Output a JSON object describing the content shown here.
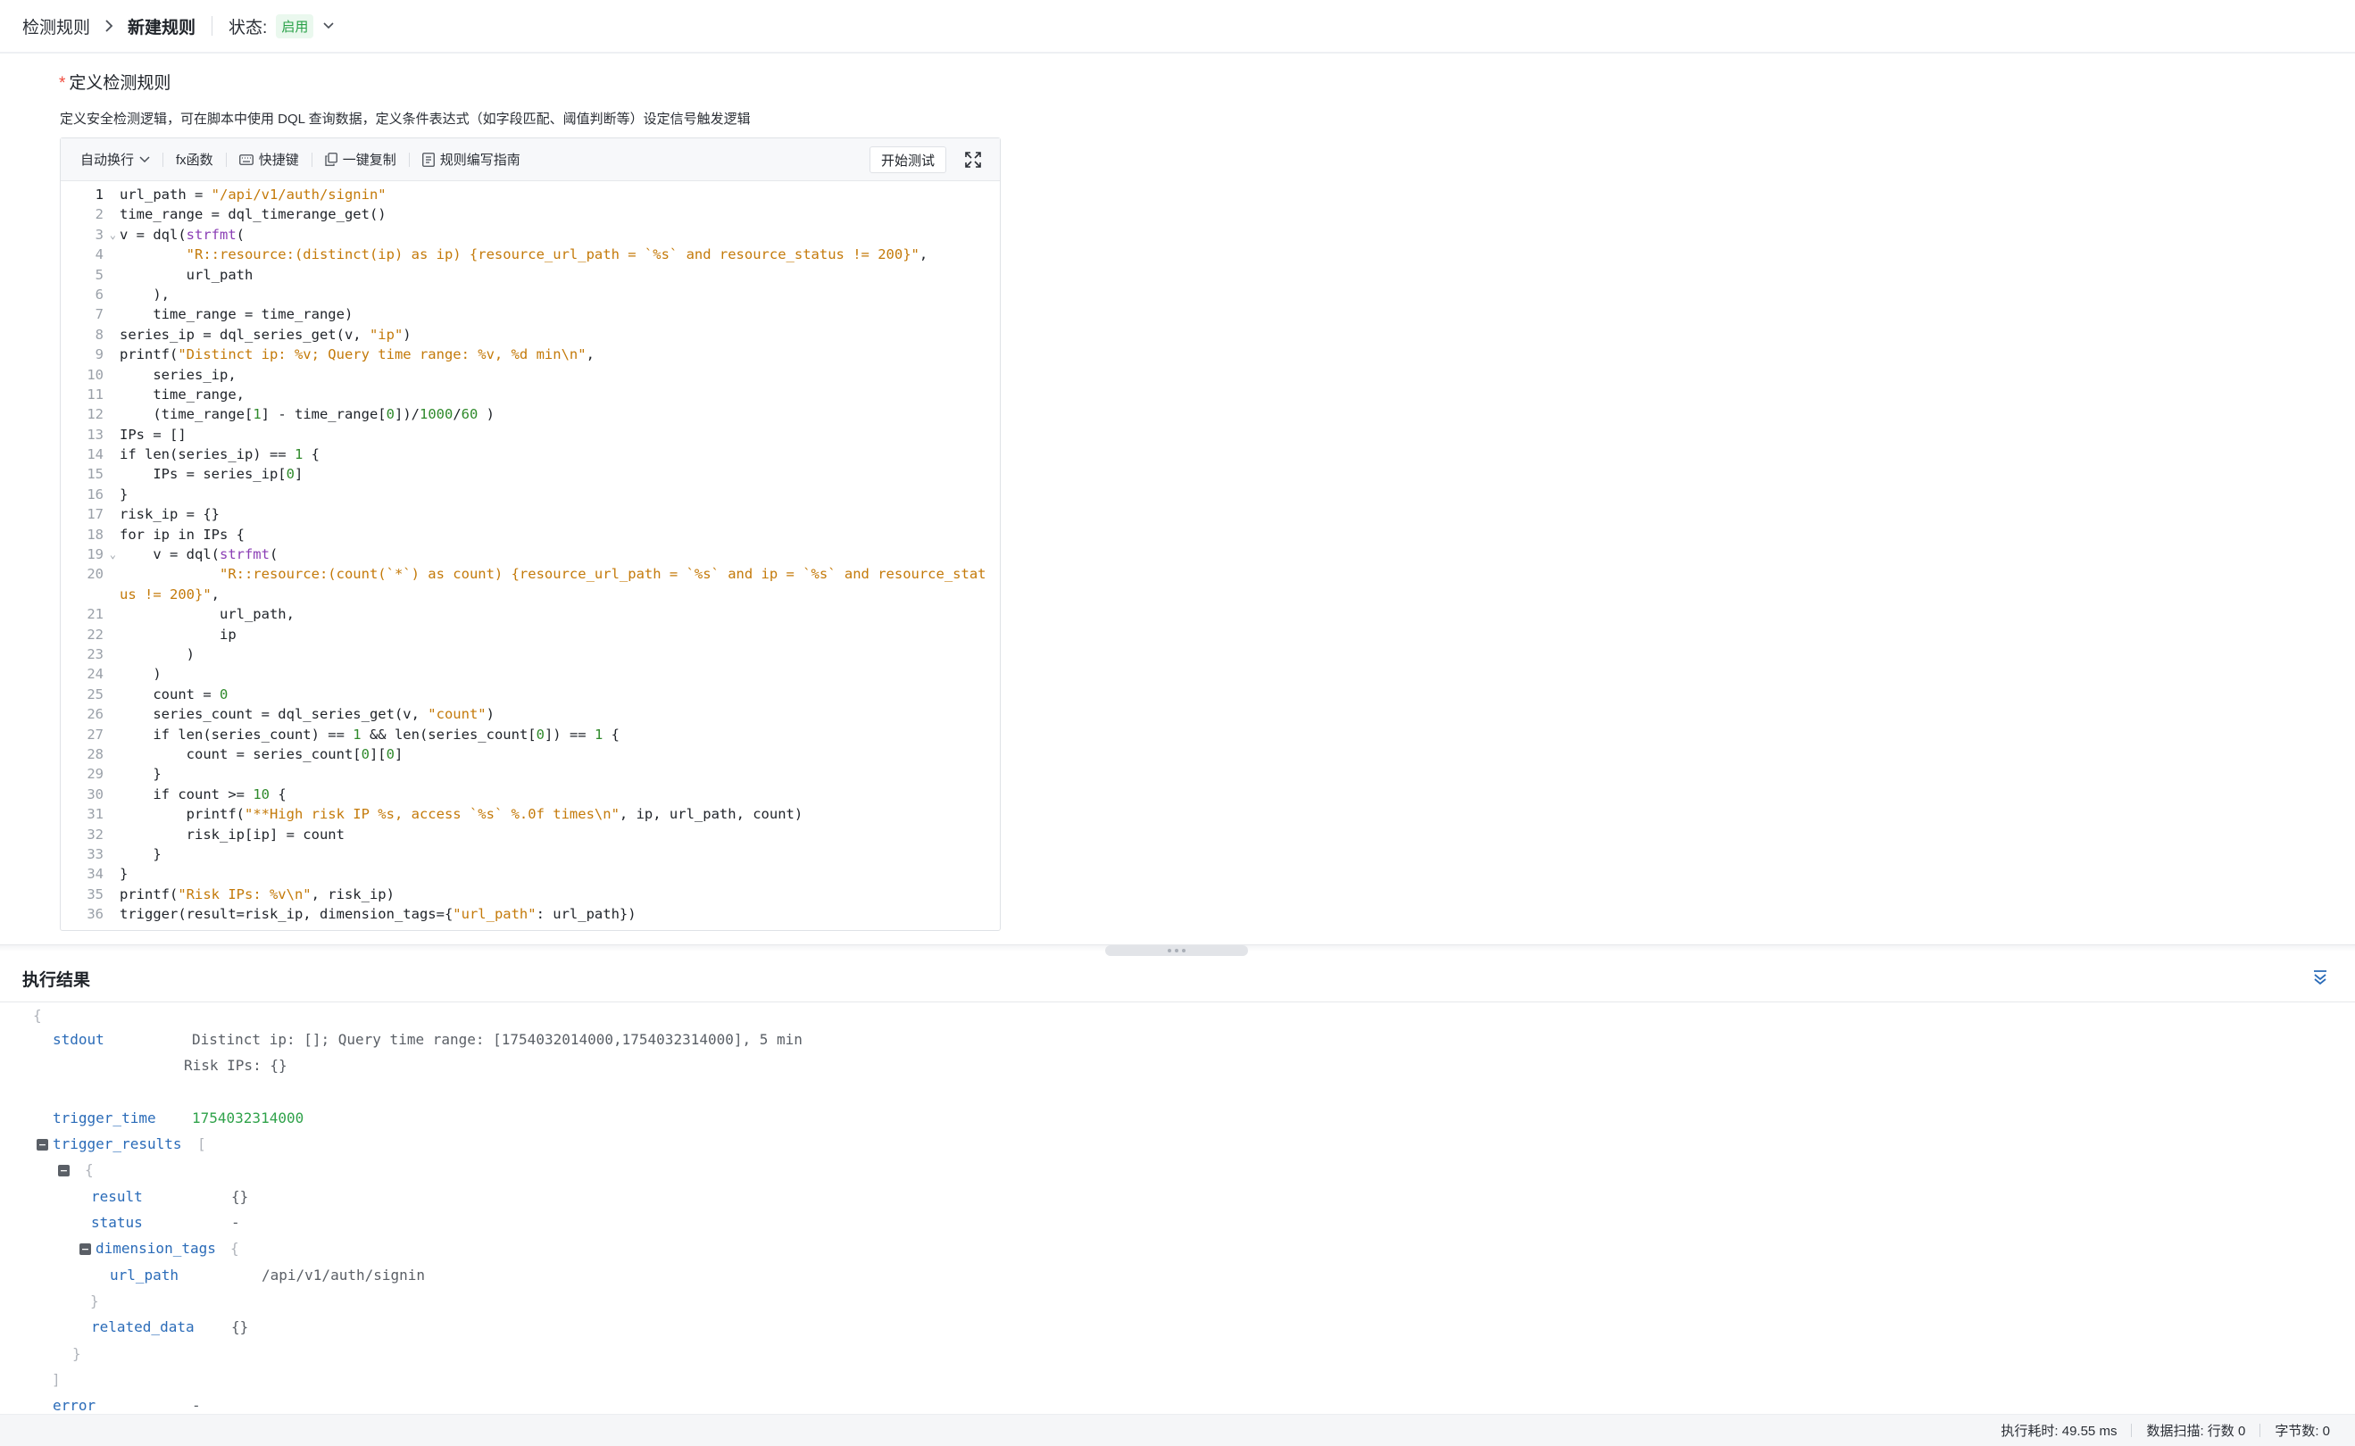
{
  "header": {
    "breadcrumb_root": "检测规则",
    "breadcrumb_current": "新建规则",
    "status_label": "状态:",
    "status_value": "启用"
  },
  "section": {
    "required_mark": "*",
    "title": "定义检测规则",
    "description": "定义安全检测逻辑，可在脚本中使用 DQL 查询数据，定义条件表达式（如字段匹配、阈值判断等）设定信号触发逻辑"
  },
  "toolbar": {
    "wrap_label": "自动换行",
    "fx_label": "fx函数",
    "shortcut_label": "快捷键",
    "copy_label": "一键复制",
    "guide_label": "规则编写指南",
    "run_label": "开始测试"
  },
  "code_lines": [
    "url_path = \"/api/v1/auth/signin\"",
    "time_range = dql_timerange_get()",
    "v = dql(strfmt(",
    "        \"R::resource:(distinct(ip) as ip) {resource_url_path = `%s` and resource_status != 200}\",",
    "        url_path",
    "    ),",
    "    time_range = time_range)",
    "series_ip = dql_series_get(v, \"ip\")",
    "printf(\"Distinct ip: %v; Query time range: %v, %d min\\n\",",
    "    series_ip,",
    "    time_range,",
    "    (time_range[1] - time_range[0])/1000/60 )",
    "IPs = []",
    "if len(series_ip) == 1 {",
    "    IPs = series_ip[0]",
    "}",
    "risk_ip = {}",
    "for ip in IPs {",
    "    v = dql(strfmt(",
    "            \"R::resource:(count(`*`) as count) {resource_url_path = `%s` and ip = `%s` and resource_status != 200}\",",
    "            url_path,",
    "            ip",
    "        )",
    "    )",
    "    count = 0",
    "    series_count = dql_series_get(v, \"count\")",
    "    if len(series_count) == 1 && len(series_count[0]) == 1 {",
    "        count = series_count[0][0]",
    "    }",
    "    if count >= 10 {",
    "        printf(\"**High risk IP %s, access `%s` %.0f times\\n\", ip, url_path, count)",
    "        risk_ip[ip] = count",
    "    }",
    "}",
    "printf(\"Risk IPs: %v\\n\", risk_ip)",
    "trigger(result=risk_ip, dimension_tags={\"url_path\": url_path})"
  ],
  "result": {
    "title": "执行结果",
    "stdout_key": "stdout",
    "stdout_line1": "Distinct ip: []; Query time range: [1754032014000,1754032314000], 5 min",
    "stdout_line2": "Risk IPs: {}",
    "trigger_time_key": "trigger_time",
    "trigger_time_value": "1754032314000",
    "trigger_results_key": "trigger_results",
    "result_key": "result",
    "result_value": "{}",
    "status_key": "status",
    "status_value": "-",
    "dimension_tags_key": "dimension_tags",
    "url_path_key": "url_path",
    "url_path_value": "/api/v1/auth/signin",
    "related_data_key": "related_data",
    "related_data_value": "{}",
    "error_key": "error",
    "error_value": "-"
  },
  "statusbar": {
    "exec_time": "执行耗时: 49.55 ms",
    "scan_rows": "数据扫描: 行数 0",
    "bytes": "字节数: 0"
  },
  "colors": {
    "accent_blue": "#2a6bb8",
    "status_green": "#27a046",
    "string_orange": "#c47a0a",
    "number_green": "#2f8a2b",
    "function_purple": "#8b3fb5"
  }
}
